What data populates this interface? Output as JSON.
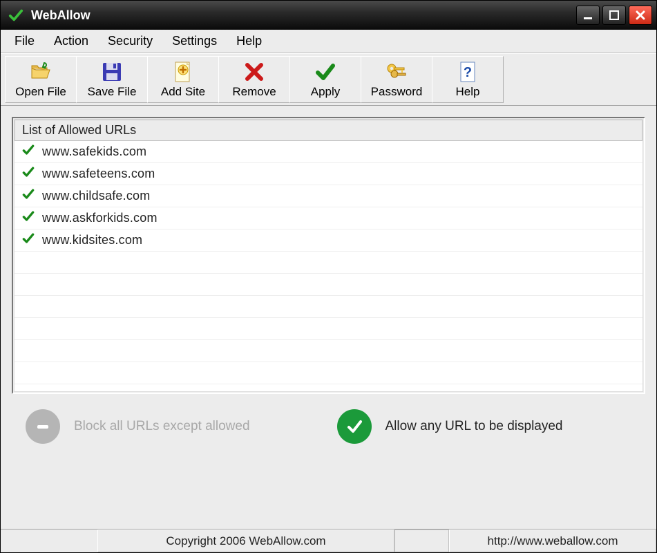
{
  "window": {
    "title": "WebAllow"
  },
  "menus": [
    "File",
    "Action",
    "Security",
    "Settings",
    "Help"
  ],
  "toolbar": [
    {
      "id": "open-file",
      "label": "Open File"
    },
    {
      "id": "save-file",
      "label": "Save File"
    },
    {
      "id": "add-site",
      "label": "Add Site"
    },
    {
      "id": "remove",
      "label": "Remove"
    },
    {
      "id": "apply",
      "label": "Apply"
    },
    {
      "id": "password",
      "label": "Password"
    },
    {
      "id": "help",
      "label": "Help"
    }
  ],
  "list": {
    "header": "List of Allowed URLs",
    "items": [
      "www.safekids.com",
      "www.safeteens.com",
      "www.childsafe.com",
      "www.askforkids.com",
      "www.kidsites.com"
    ]
  },
  "modes": {
    "block_label": "Block all URLs except allowed",
    "allow_label": "Allow any URL to be displayed"
  },
  "status": {
    "copyright": "Copyright 2006 WebAllow.com",
    "url": "http://www.weballow.com"
  }
}
